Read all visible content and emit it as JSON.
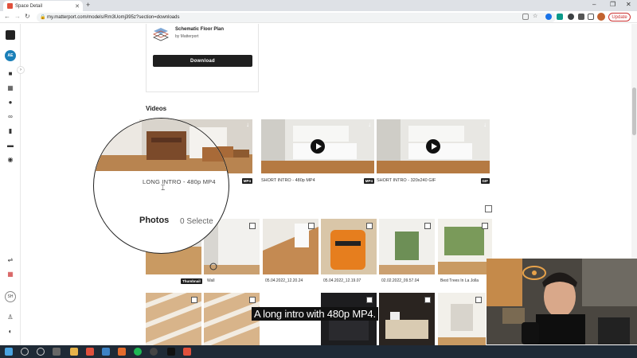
{
  "browser": {
    "tab_title": "Space Detail",
    "url": "my.matterport.com/models/Rm3Uomj395z?section=downloads",
    "update_label": "Update"
  },
  "sidebar": {
    "avatar_initials": "AE",
    "bottom_avatar_initials": "SH"
  },
  "floor_plan": {
    "title": "Schematic Floor Plan",
    "by": "by Matterport",
    "download_label": "Download"
  },
  "videos": {
    "title": "Videos",
    "items": [
      {
        "label": "LONG INTRO - 480p MP4",
        "badge": "MP4"
      },
      {
        "label": "SHORT INTRO - 480p MP4",
        "badge": "MP4"
      },
      {
        "label": "SHORT INTRO - 320x240 GIF",
        "badge": "GIF"
      }
    ]
  },
  "photos": {
    "title": "Photos",
    "selected_text": "0 Selecte",
    "thumbnail_badge": "Thumbnail",
    "labels": [
      "Wall",
      "05.04.2022_12.20.24",
      "05.04.2022_12.19.07",
      "02.02.2022_09.57.04",
      "Best Trees In La Jolla"
    ]
  },
  "caption": "A long intro with 480p MP4."
}
